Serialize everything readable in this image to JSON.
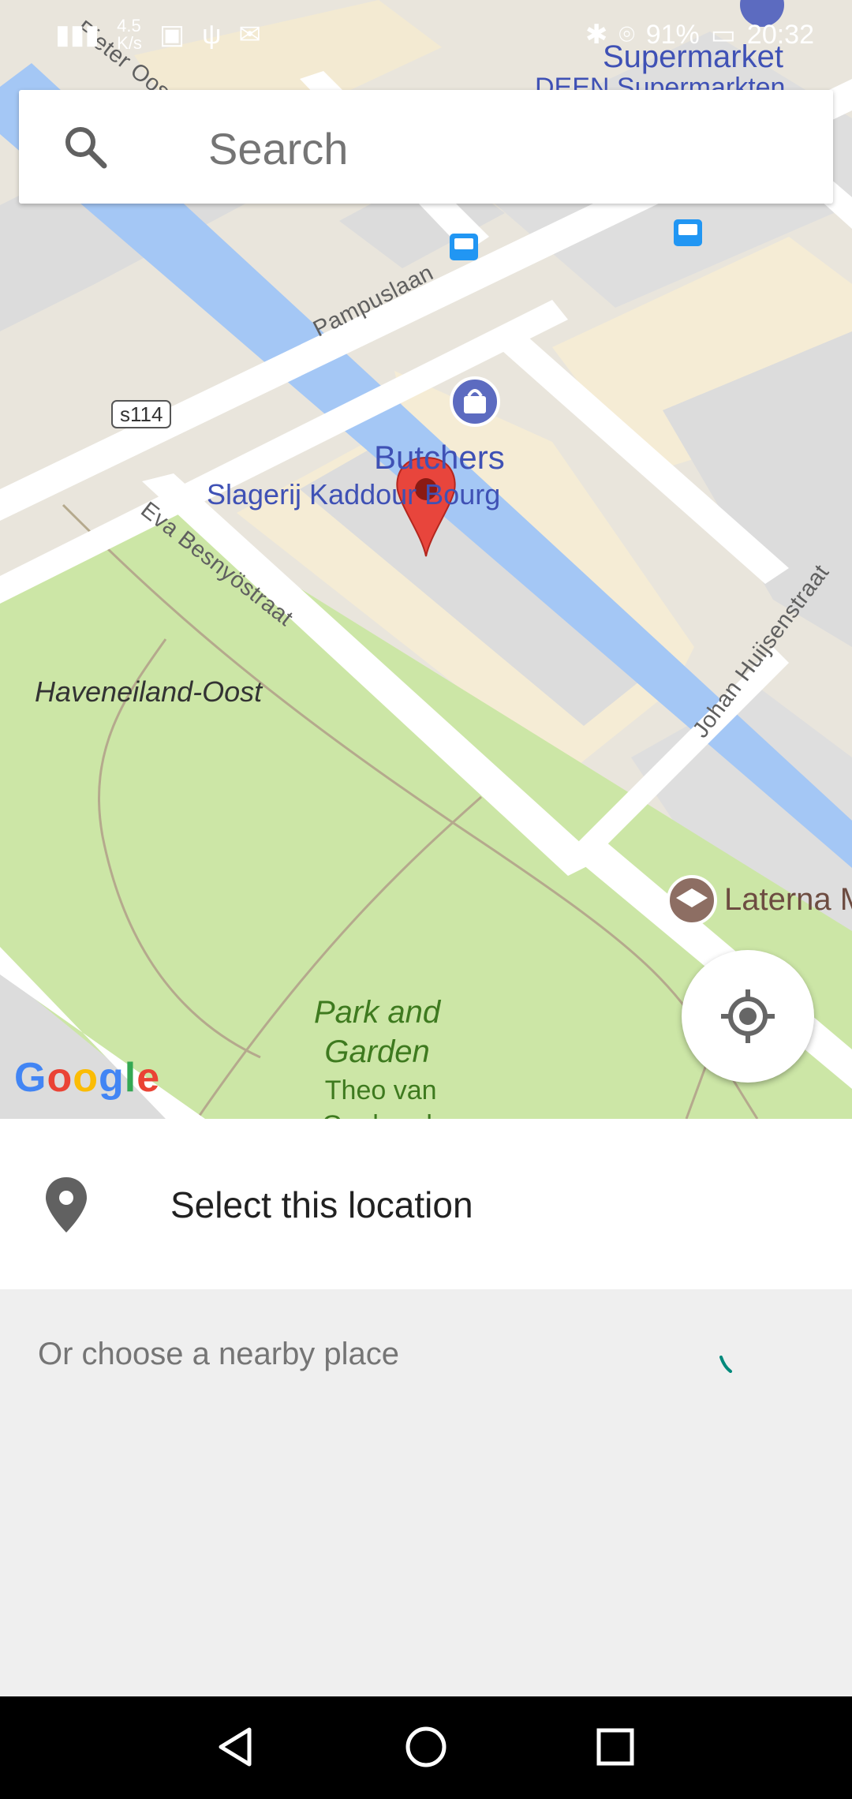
{
  "status_bar": {
    "network_speed": "4.5\nK/s",
    "battery": "91%",
    "time": "20:32"
  },
  "search": {
    "placeholder": "Search"
  },
  "map": {
    "labels": {
      "supermarket": "Supermarket",
      "supermarket_name": "DEEN Supermarkten",
      "street_pieter": "Pieter Oosterhuisstraat",
      "street_pampus": "Pampuslaan",
      "road_shield": "s114",
      "poi_category": "Butchers",
      "poi_name": "Slagerij Kaddour Bourg",
      "street_eva": "Eva Besnyöstraat",
      "area": "Haveneiland-Oost",
      "street_johan": "Johan Huijsenstraat",
      "school": "Laterna M",
      "park_category": "Park and\nGarden",
      "park_name": "Theo van\nGoghpark"
    },
    "attribution": "Google",
    "colors": {
      "water": "#a4c7f5",
      "park": "#cce6a6",
      "building": "#f5ecd5",
      "block": "#dcdcdc",
      "pin": "#e8453c",
      "poi": "#3f51b5",
      "park_text": "#3e7a1f"
    }
  },
  "bottom": {
    "select_label": "Select this location",
    "nearby_label": "Or choose a nearby place",
    "spinner_color": "#00897b"
  },
  "icons": {
    "search": "search-icon",
    "my_location": "my-location-icon",
    "place": "place-pin-icon",
    "back": "back-icon",
    "home": "home-icon",
    "recents": "recents-icon"
  }
}
